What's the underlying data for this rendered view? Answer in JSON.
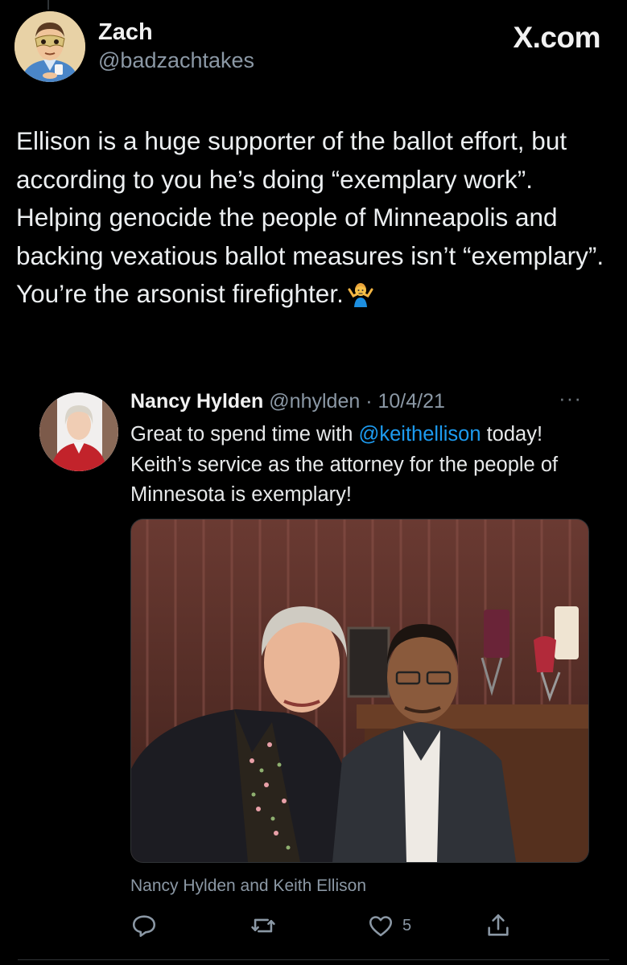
{
  "header": {
    "author_name": "Zach",
    "author_handle": "@badzachtakes",
    "source_label": "X.com"
  },
  "tweet": {
    "text": "Ellison is a huge supporter of the ballot effort, but according to you he’s doing “exemplary work”. Helping genocide the people of Minneapolis and backing vexatious ballot measures isn’t “exemplary”. You’re the arsonist firefighter.",
    "emoji": "person-shrugging-icon"
  },
  "quoted": {
    "name": "Nancy Hylden",
    "handle": "@nhylden",
    "separator": "·",
    "date": "10/4/21",
    "more": "···",
    "text_before": "Great to spend time with ",
    "mention": "@keithellison",
    "text_after": " today!  Keith’s service as the attorney for the people of Minnesota is exemplary!",
    "photo_caption": "Nancy Hylden and Keith Ellison"
  },
  "actions": {
    "like_count": "5"
  },
  "colors": {
    "background": "#000000",
    "text": "#e7e9ea",
    "secondary": "#8b98a5",
    "accent": "#1d9bf0"
  }
}
